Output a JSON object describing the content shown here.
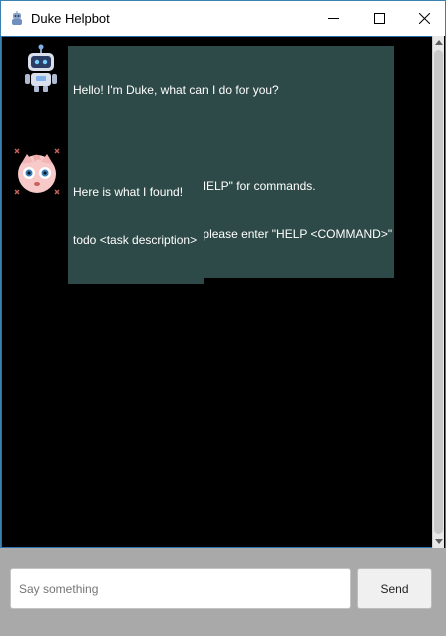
{
  "window": {
    "title": "Duke Helpbot",
    "icon": "robot-icon",
    "controls": [
      "minimize-icon",
      "maximize-icon",
      "close-icon"
    ]
  },
  "messages": [
    {
      "sender": "bot",
      "avatar": "robot-avatar",
      "lines": [
        "Hello! I'm Duke, what can I do for you?",
        "",
        "For help, please enter \"HELP\" for commands.",
        "For help on commands, please enter \"HELP <COMMAND>\""
      ]
    },
    {
      "sender": "user",
      "avatar": "jigglypuff-avatar",
      "lines": [
        "Here is what I found!",
        "todo <task description>"
      ]
    }
  ],
  "input": {
    "placeholder": "Say something",
    "value": ""
  },
  "send_button": {
    "label": "Send"
  },
  "colors": {
    "chat_background": "#000000",
    "bubble": "#2e4a48",
    "bottom_bar": "#a9a9a9",
    "window_border": "#3c7fb1"
  }
}
